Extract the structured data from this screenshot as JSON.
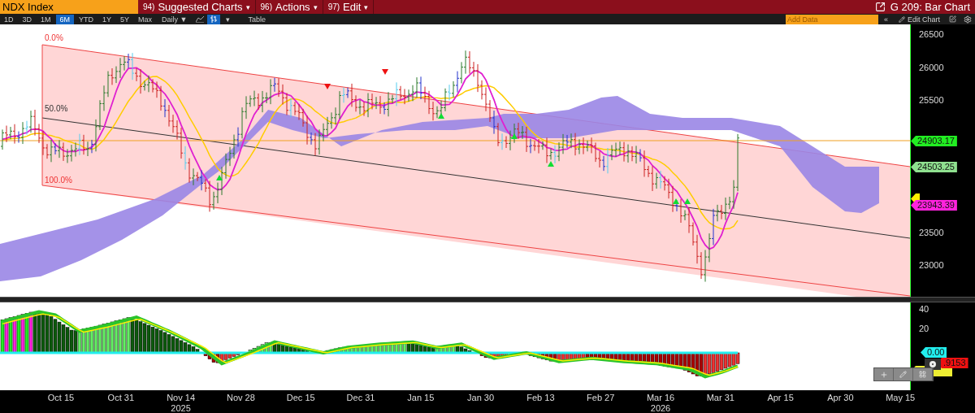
{
  "header": {
    "security": "NDX Index",
    "menus": [
      {
        "number": "94)",
        "label": "Suggested Charts",
        "caret": "▾"
      },
      {
        "number": "96)",
        "label": "Actions",
        "caret": "▾"
      },
      {
        "number": "97)",
        "label": "Edit",
        "caret": "▾"
      }
    ],
    "title": "G 209: Bar Chart"
  },
  "toolbar": {
    "periods": [
      {
        "label": "1D",
        "selected": false
      },
      {
        "label": "3D",
        "selected": false
      },
      {
        "label": "1M",
        "selected": false
      },
      {
        "label": "6M",
        "selected": true
      },
      {
        "label": "YTD",
        "selected": false
      },
      {
        "label": "1Y",
        "selected": false
      },
      {
        "label": "5Y",
        "selected": false
      },
      {
        "label": "Max",
        "selected": false
      }
    ],
    "frequency": "Daily ▼",
    "chart_types": [
      {
        "kind": "line",
        "selected": false
      },
      {
        "kind": "bar",
        "selected": true
      }
    ],
    "type_caret": "▾",
    "table": "Table",
    "add_data": {
      "placeholder": "Add Data"
    },
    "collapse": "«",
    "edit_chart": "Edit Chart"
  },
  "price_panel": {
    "channel_labels": [
      "0.0%",
      "50.0%",
      "100.0%"
    ],
    "y_ticks": [
      "26500",
      "26000",
      "25500",
      "23500",
      "23000"
    ],
    "value_tags": [
      {
        "label": "24903.17",
        "color": "#22ee22"
      },
      {
        "label": "24503.25",
        "color": "#8fe08f"
      },
      {
        "label": "23943.39",
        "color": "#ff22dd"
      }
    ]
  },
  "oscillator_panel": {
    "y_ticks": [
      "40",
      "20"
    ],
    "value_tags": [
      {
        "label": "0.00",
        "color": "#22eeee"
      },
      {
        "label": ".9153",
        "color": "#ee1111"
      }
    ]
  },
  "x_axis": {
    "dates": [
      {
        "label": "Oct 15"
      },
      {
        "label": "Oct 31"
      },
      {
        "label": "Nov 14",
        "year": "2025"
      },
      {
        "label": "Nov 28"
      },
      {
        "label": "Dec 15"
      },
      {
        "label": "Dec 31"
      },
      {
        "label": "Jan 15"
      },
      {
        "label": "Jan 30"
      },
      {
        "label": "Feb 13"
      },
      {
        "label": "Feb 27"
      },
      {
        "label": "Mar 16",
        "year": "2026"
      },
      {
        "label": "Mar 31"
      },
      {
        "label": "Apr 15"
      },
      {
        "label": "Apr 30"
      },
      {
        "label": "May 15"
      }
    ]
  }
}
